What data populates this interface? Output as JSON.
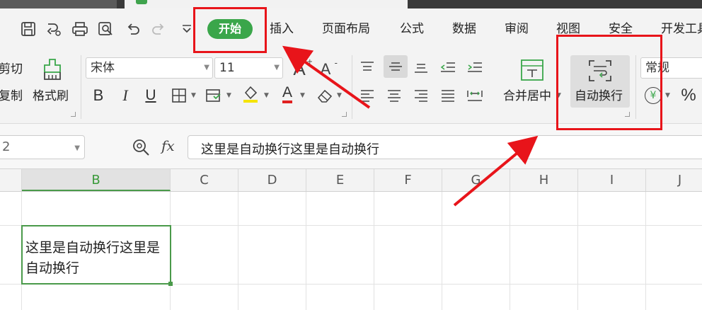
{
  "quick_access": [
    "save-icon",
    "history-icon",
    "print-icon",
    "print-preview-icon",
    "undo-icon",
    "redo-icon",
    "more-chevron-icon"
  ],
  "menu": {
    "active_tab": "开始",
    "tabs": [
      "插入",
      "页面布局",
      "公式",
      "数据",
      "审阅",
      "视图",
      "安全",
      "开发工具"
    ]
  },
  "ribbon": {
    "cut_label": "剪切",
    "copy_label": "复制",
    "format_painter_label": "格式刷",
    "font_name": "宋体",
    "font_size": "11",
    "bold": "B",
    "italic": "I",
    "underline": "U",
    "font_color_glyph": "A",
    "increase_font": "A",
    "decrease_font": "A",
    "merge_center_label": "合并居中",
    "wrap_text_label": "自动换行",
    "number_format": "常规",
    "currency_glyph": "¥",
    "percent_glyph": "%"
  },
  "formula_bar": {
    "name_box": "2",
    "fx_label": "fx",
    "content": "这里是自动换行这里是自动换行"
  },
  "columns": [
    "B",
    "C",
    "D",
    "E",
    "F",
    "G",
    "H",
    "I",
    "J"
  ],
  "selected_column": "B",
  "cell_text": "这里是自动换行这里是自动换行",
  "colors": {
    "accent_green": "#3aa64a",
    "annotation_red": "#e8141a"
  }
}
